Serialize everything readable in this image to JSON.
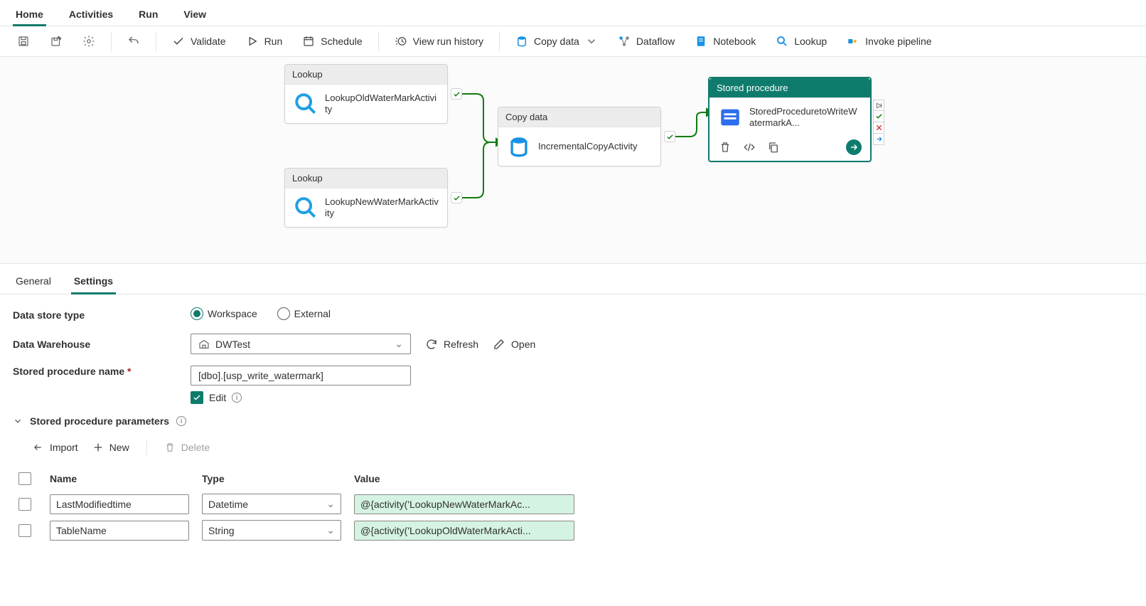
{
  "topTabs": {
    "home": "Home",
    "activities": "Activities",
    "run": "Run",
    "view": "View",
    "active": "home"
  },
  "toolbar": {
    "validate": "Validate",
    "run": "Run",
    "schedule": "Schedule",
    "viewRunHistory": "View run history",
    "copyData": "Copy data",
    "dataflow": "Dataflow",
    "notebook": "Notebook",
    "lookup": "Lookup",
    "invokePipeline": "Invoke pipeline"
  },
  "canvas": {
    "activities": {
      "lookupOld": {
        "type": "Lookup",
        "name": "LookupOldWaterMarkActivity"
      },
      "lookupNew": {
        "type": "Lookup",
        "name": "LookupNewWaterMarkActivity"
      },
      "copy": {
        "type": "Copy data",
        "name": "IncrementalCopyActivity"
      },
      "sp": {
        "type": "Stored procedure",
        "name": "StoredProceduretoWriteWatermarkA..."
      }
    }
  },
  "propTabs": {
    "general": "General",
    "settings": "Settings",
    "active": "settings"
  },
  "settings": {
    "dataStoreTypeLabel": "Data store type",
    "radioWorkspace": "Workspace",
    "radioExternal": "External",
    "dataWarehouseLabel": "Data Warehouse",
    "dataWarehouseValue": "DWTest",
    "refresh": "Refresh",
    "open": "Open",
    "spNameLabel": "Stored procedure name",
    "spNameValue": "[dbo].[usp_write_watermark]",
    "edit": "Edit",
    "paramsHeader": "Stored procedure parameters",
    "import": "Import",
    "new": "New",
    "delete": "Delete",
    "cols": {
      "name": "Name",
      "type": "Type",
      "value": "Value"
    },
    "rows": [
      {
        "name": "LastModifiedtime",
        "type": "Datetime",
        "value": "@{activity('LookupNewWaterMarkAc..."
      },
      {
        "name": "TableName",
        "type": "String",
        "value": "@{activity('LookupOldWaterMarkActi..."
      }
    ]
  }
}
